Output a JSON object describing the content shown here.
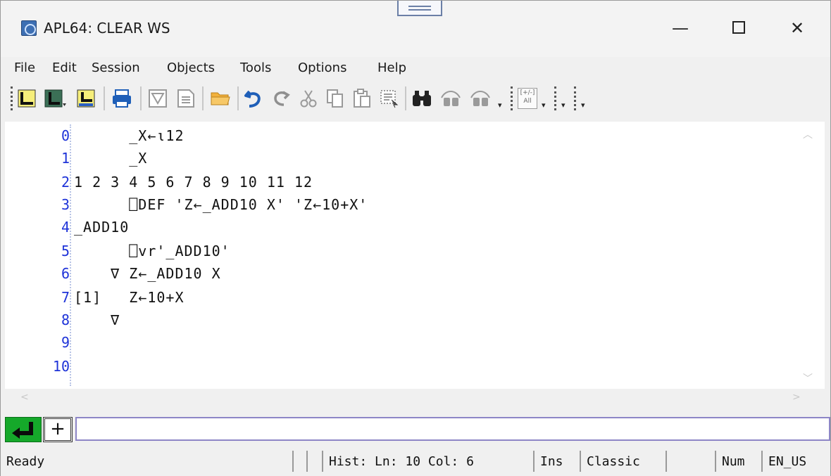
{
  "window": {
    "title": "APL64: CLEAR WS",
    "controls": {
      "minimize": "—",
      "close": "✕"
    }
  },
  "menu": [
    {
      "label": "File"
    },
    {
      "label": "Edit"
    },
    {
      "label": "Session"
    },
    {
      "label": "Objects"
    },
    {
      "label": "Tools"
    },
    {
      "label": "Options"
    },
    {
      "label": "Help"
    }
  ],
  "toolbar": {
    "icons": [
      "new-function-icon",
      "new-variable-icon",
      "new-operator-icon",
      "print-icon",
      "edit-del-icon",
      "edit-page-icon",
      "open-folder-icon",
      "undo-icon",
      "redo-icon",
      "cut-icon",
      "copy-icon",
      "paste-icon",
      "select-all-icon",
      "find-icon",
      "find-prev-icon",
      "find-next-icon",
      "toggle-sign-icon"
    ],
    "toggle_label_top": "[+/-]",
    "toggle_label_bottom": "All"
  },
  "session": {
    "lines": [
      {
        "num": "0",
        "text": "      _X←⍳12"
      },
      {
        "num": "1",
        "text": "      _X"
      },
      {
        "num": "2",
        "text": "1 2 3 4 5 6 7 8 9 10 11 12"
      },
      {
        "num": "3",
        "text": "      ⎕DEF 'Z←_ADD10 X' 'Z←10+X'"
      },
      {
        "num": "4",
        "text": "_ADD10"
      },
      {
        "num": "5",
        "text": "      ⎕vr'_ADD10'"
      },
      {
        "num": "6",
        "text": "    ∇ Z←_ADD10 X"
      },
      {
        "num": "7",
        "text": "[1]   Z←10+X"
      },
      {
        "num": "8",
        "text": "    ∇"
      },
      {
        "num": "9",
        "text": ""
      },
      {
        "num": "10",
        "text": ""
      }
    ]
  },
  "input": {
    "value": "",
    "plus_label": "+"
  },
  "status": {
    "ready": "Ready",
    "hist": "Hist: Ln: 10 Col: 6",
    "mode": "Ins",
    "keyboard": "Classic",
    "num": "Num",
    "locale": "EN_US"
  },
  "colors": {
    "line_numbers": "#1e33d8",
    "enter_button": "#15a82a",
    "input_border": "#8d86c6",
    "toolbar_blue": "#1f5fb8"
  }
}
